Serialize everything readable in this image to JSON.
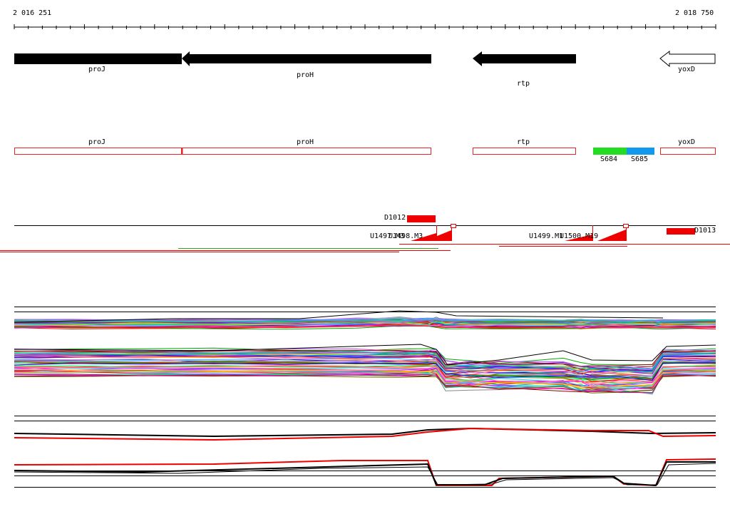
{
  "ruler": {
    "start_label": "2 016 251",
    "end_label": "2 018 750"
  },
  "genes": [
    {
      "name": "proJ",
      "direction": "forward",
      "fill": "black"
    },
    {
      "name": "proH",
      "direction": "reverse",
      "fill": "black"
    },
    {
      "name": "rtp",
      "direction": "reverse",
      "fill": "black"
    },
    {
      "name": "yoxD",
      "direction": "reverse",
      "fill": "white"
    }
  ],
  "transcripts": [
    {
      "name": "proJ"
    },
    {
      "name": "proH"
    },
    {
      "name": "rtp"
    },
    {
      "name": "yoxD"
    }
  ],
  "segments": [
    {
      "name": "S684",
      "color": "#22dd22"
    },
    {
      "name": "S685",
      "color": "#1199ee"
    }
  ],
  "features": {
    "d1012": "D1012",
    "d1013": "D1013",
    "u1497": "U1497.M3",
    "u1498": "U1498.M3",
    "u1499": "U1499.M1",
    "u1500": "U1500.M19"
  },
  "colors": {
    "gene_fill": "#000000",
    "transcript_outline": "#ee2222",
    "feature_red": "#ee0000",
    "axis": "#000000"
  }
}
